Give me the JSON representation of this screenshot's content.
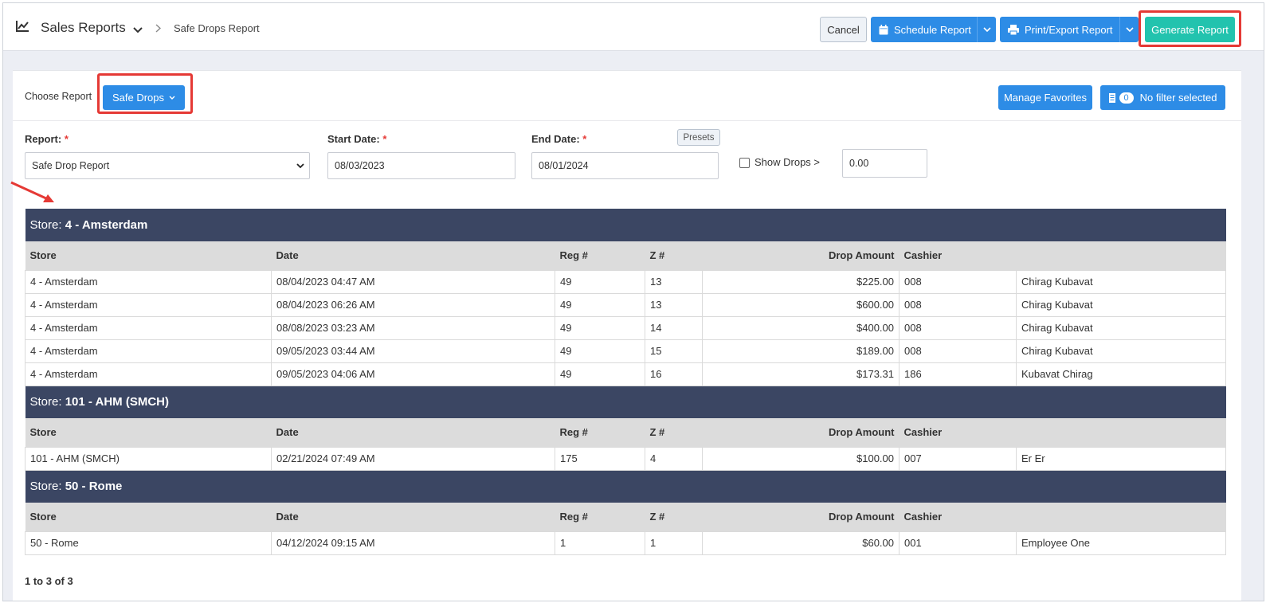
{
  "header": {
    "title": "Sales Reports",
    "breadcrumb": "Safe Drops Report",
    "cancel": "Cancel",
    "schedule": "Schedule Report",
    "print": "Print/Export Report",
    "generate": "Generate Report"
  },
  "toolbar": {
    "choose_label": "Choose Report",
    "report_button": "Safe Drops",
    "favorites": "Manage Favorites",
    "filter_count": "0",
    "filter_label": "No filter selected"
  },
  "filters": {
    "report_label": "Report:",
    "report_value": "Safe Drop Report",
    "start_label": "Start Date:",
    "start_value": "08/03/2023",
    "end_label": "End Date:",
    "end_value": "08/01/2024",
    "presets": "Presets",
    "show_drops_label": "Show Drops >",
    "show_drops_value": "0.00",
    "required_mark": "*"
  },
  "columns": [
    "Store",
    "Date",
    "Reg #",
    "Z #",
    "Drop Amount",
    "Cashier"
  ],
  "group_prefix": "Store:",
  "groups": [
    {
      "store": "4 - Amsterdam",
      "rows": [
        [
          "4 - Amsterdam",
          "08/04/2023 04:47 AM",
          "49",
          "13",
          "$225.00",
          "008",
          "Chirag Kubavat"
        ],
        [
          "4 - Amsterdam",
          "08/04/2023 06:26 AM",
          "49",
          "13",
          "$600.00",
          "008",
          "Chirag Kubavat"
        ],
        [
          "4 - Amsterdam",
          "08/08/2023 03:23 AM",
          "49",
          "14",
          "$400.00",
          "008",
          "Chirag Kubavat"
        ],
        [
          "4 - Amsterdam",
          "09/05/2023 03:44 AM",
          "49",
          "15",
          "$189.00",
          "008",
          "Chirag Kubavat"
        ],
        [
          "4 - Amsterdam",
          "09/05/2023 04:06 AM",
          "49",
          "16",
          "$173.31",
          "186",
          "Kubavat Chirag"
        ]
      ]
    },
    {
      "store": "101 - AHM (SMCH)",
      "rows": [
        [
          "101 - AHM (SMCH)",
          "02/21/2024 07:49 AM",
          "175",
          "4",
          "$100.00",
          "007",
          "Er Er"
        ]
      ]
    },
    {
      "store": "50 - Rome",
      "rows": [
        [
          "50 - Rome",
          "04/12/2024 09:15 AM",
          "1",
          "1",
          "$60.00",
          "001",
          "Employee One"
        ]
      ]
    }
  ],
  "pager": "1 to 3 of 3",
  "colors": {
    "primary": "#2d8ce6",
    "success": "#22c3ae",
    "group_header": "#3b4663",
    "highlight": "#e53935"
  }
}
